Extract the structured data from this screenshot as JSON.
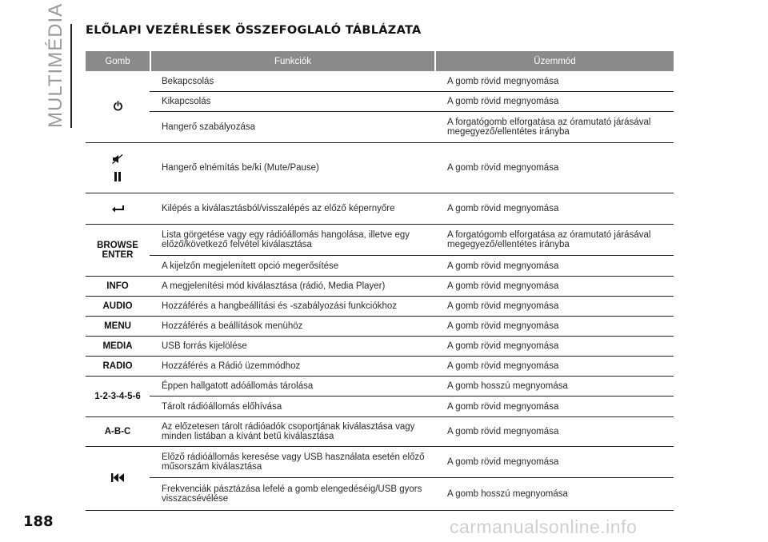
{
  "section_label": "MULTIMÉDIA",
  "title": "ELŐLAPI VEZÉRLÉSEK ÖSSZEFOGLALÓ TÁBLÁZATA",
  "headers": {
    "button": "Gomb",
    "function": "Funkciók",
    "mode": "Üzemmód"
  },
  "groups": [
    {
      "key": "",
      "icon": "power-icon",
      "rows": [
        {
          "function": "Bekapcsolás",
          "mode": "A gomb rövid megnyomása"
        },
        {
          "function": "Kikapcsolás",
          "mode": "A gomb rövid megnyomása"
        },
        {
          "function": "Hangerő szabályozása",
          "mode": "A forgatógomb elforgatása az óramutató járásával megegyező/ellentétes irányba"
        }
      ]
    },
    {
      "key": "",
      "icon": "mute-pause-icon",
      "rows": [
        {
          "function": "Hangerő elnémítás be/ki (Mute/Pause)",
          "mode": "A gomb rövid megnyomása"
        }
      ]
    },
    {
      "key": "",
      "icon": "back-arrow-icon",
      "rows": [
        {
          "function": "Kilépés a kiválasztásból/visszalépés az előző képernyőre",
          "mode": "A gomb rövid megnyomása"
        }
      ]
    },
    {
      "key": "BROWSE\nENTER",
      "icon": "",
      "rows": [
        {
          "function": "Lista görgetése vagy egy rádióállomás hangolása, illetve egy előző/következő felvétel kiválasztása",
          "mode": "A forgatógomb elforgatása az óramutató járásával megegyező/ellentétes irányba"
        },
        {
          "function": "A kijelzőn megjelenített opció megerősítése",
          "mode": "A gomb rövid megnyomása"
        }
      ]
    },
    {
      "key": "INFO",
      "icon": "",
      "rows": [
        {
          "function": "A megjelenítési mód kiválasztása (rádió, Media Player)",
          "mode": "A gomb rövid megnyomása"
        }
      ]
    },
    {
      "key": "AUDIO",
      "icon": "",
      "rows": [
        {
          "function": "Hozzáférés a hangbeállítási és -szabályozási funkciókhoz",
          "mode": "A gomb rövid megnyomása"
        }
      ]
    },
    {
      "key": "MENU",
      "icon": "",
      "rows": [
        {
          "function": "Hozzáférés a beállítások menühöz",
          "mode": "A gomb rövid megnyomása"
        }
      ]
    },
    {
      "key": "MEDIA",
      "icon": "",
      "rows": [
        {
          "function": "USB forrás kijelölése",
          "mode": "A gomb rövid megnyomása"
        }
      ]
    },
    {
      "key": "RADIO",
      "icon": "",
      "rows": [
        {
          "function": "Hozzáférés a Rádió üzemmódhoz",
          "mode": "A gomb rövid megnyomása"
        }
      ]
    },
    {
      "key": "1-2-3-4-5-6",
      "icon": "",
      "rows": [
        {
          "function": "Éppen hallgatott adóállomás tárolása",
          "mode": "A gomb hosszú megnyomása"
        },
        {
          "function": "Tárolt rádióállomás előhívása",
          "mode": "A gomb rövid megnyomása"
        }
      ]
    },
    {
      "key": "A-B-C",
      "icon": "",
      "rows": [
        {
          "function": "Az előzetesen tárolt rádióadók csoportjának kiválasztása vagy minden listában a kívánt betű kiválasztása",
          "mode": "A gomb rövid megnyomása"
        }
      ]
    },
    {
      "key": "",
      "icon": "skip-back-icon",
      "rows": [
        {
          "function": "Előző rádióállomás keresése vagy USB használata esetén előző műsorszám kiválasztása",
          "mode": "A gomb rövid megnyomása"
        },
        {
          "function": "Frekvenciák pásztázása lefelé a gomb elengedéséig/USB gyors visszacsévélése",
          "mode": "A gomb hosszú megnyomása"
        }
      ]
    }
  ],
  "page_number": "188",
  "watermark": "carmanualsonline.info"
}
